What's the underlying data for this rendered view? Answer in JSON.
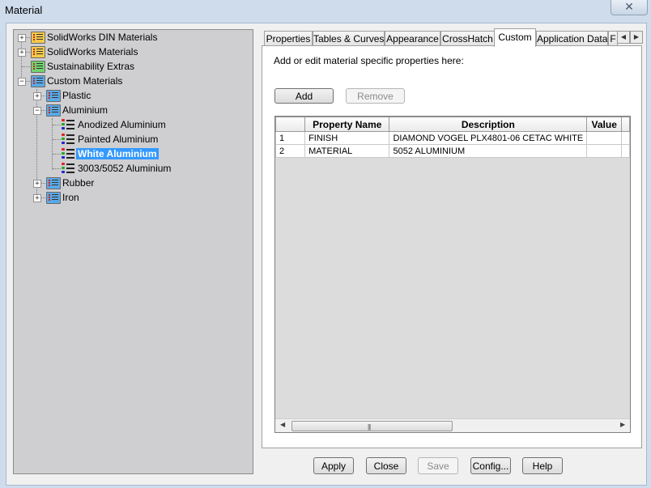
{
  "window": {
    "title": "Material"
  },
  "tree": {
    "nodes": [
      {
        "label": "SolidWorks DIN Materials"
      },
      {
        "label": "SolidWorks Materials"
      },
      {
        "label": "Sustainability Extras"
      },
      {
        "label": "Custom Materials"
      },
      {
        "label": "Plastic"
      },
      {
        "label": "Aluminium"
      },
      {
        "label": "Anodized Aluminium"
      },
      {
        "label": "Painted Aluminium"
      },
      {
        "label": "White Aluminium"
      },
      {
        "label": "3003/5052 Aluminium"
      },
      {
        "label": "Rubber"
      },
      {
        "label": "Iron"
      }
    ],
    "selected": "White Aluminium"
  },
  "tabs": [
    {
      "label": "Properties"
    },
    {
      "label": "Tables & Curves"
    },
    {
      "label": "Appearance"
    },
    {
      "label": "CrossHatch"
    },
    {
      "label": "Custom"
    },
    {
      "label": "Application Data"
    },
    {
      "label": "F"
    }
  ],
  "active_tab": "Custom",
  "custom": {
    "hint": "Add or edit material specific properties here:",
    "add_label": "Add",
    "remove_label": "Remove",
    "grid": {
      "columns": [
        "",
        "Property Name",
        "Description",
        "Value"
      ],
      "rows": [
        [
          "1",
          "FINISH",
          "DIAMOND VOGEL PLX4801-06 CETAC WHITE",
          ""
        ],
        [
          "2",
          "MATERIAL",
          "5052 ALUMINIUM",
          ""
        ]
      ],
      "scroll_grip": "|||"
    }
  },
  "footer": {
    "apply": "Apply",
    "close": "Close",
    "save": "Save",
    "config": "Config...",
    "help": "Help"
  },
  "icons": {
    "close": "close-icon",
    "expand": "plus-icon",
    "collapse": "minus-icon",
    "folder": "material-folder-icon",
    "material": "material-icon",
    "scroll_left": "left-arrow-icon",
    "scroll_right": "right-arrow-icon"
  },
  "colors": {
    "selection": "#3399ff",
    "tree_bg": "#cfcfd2",
    "folder_yellow": "#f3c94a",
    "folder_green": "#6fd36f",
    "folder_blue": "#5aa9e6"
  }
}
